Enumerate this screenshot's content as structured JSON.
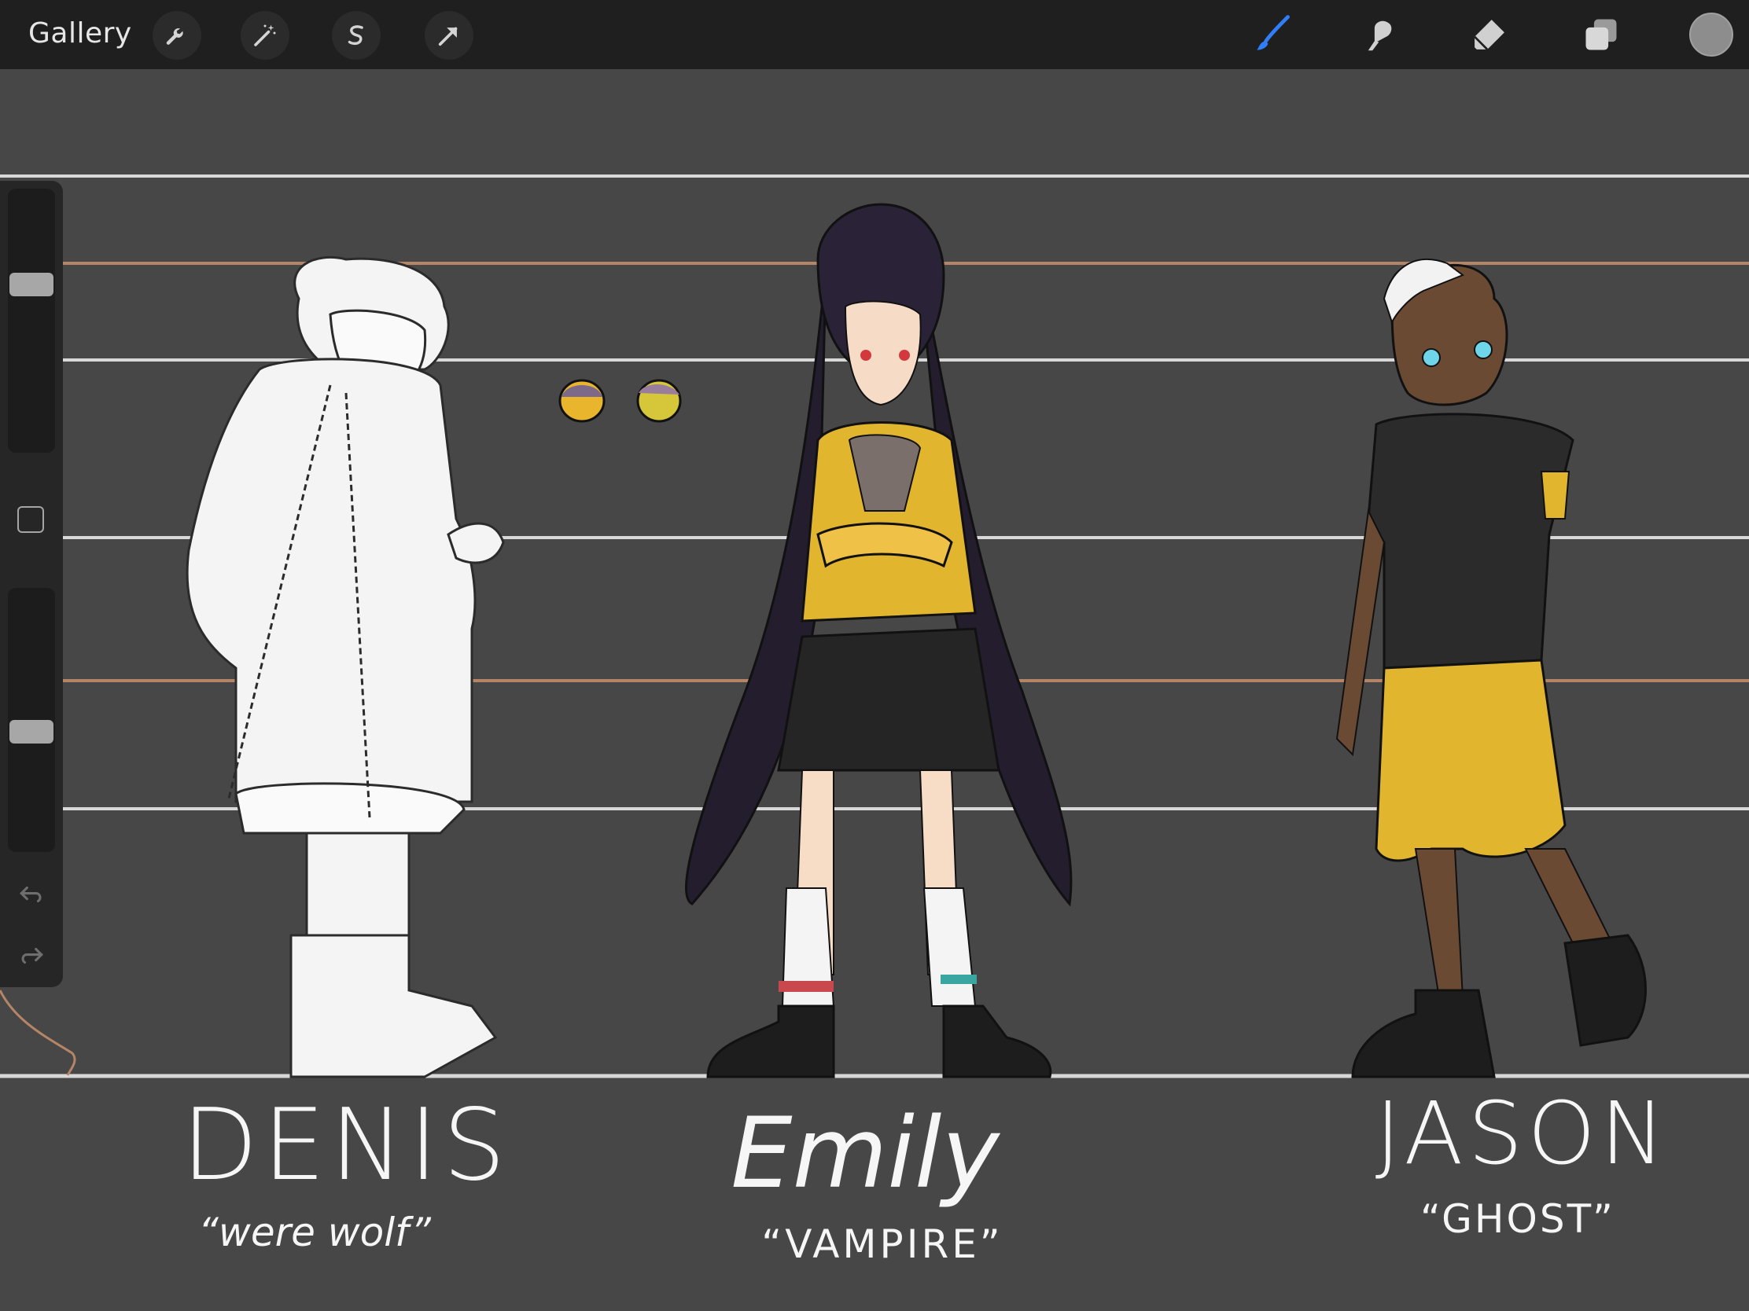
{
  "toolbar": {
    "gallery_label": "Gallery",
    "left_tools": [
      "wrench-icon",
      "magic-wand-icon",
      "selection-s-icon",
      "transform-arrow-icon"
    ],
    "right_tools": [
      "brush-icon",
      "smudge-icon",
      "eraser-icon",
      "layers-icon"
    ],
    "current_color": "#8d8d8d"
  },
  "sidebar": {
    "brush_size_level": 0.65,
    "opacity_level": 0.45,
    "buttons": [
      "modify-button",
      "undo-button",
      "redo-button"
    ]
  },
  "canvas": {
    "background": "#474747",
    "characters": [
      {
        "name": "DENIS",
        "role": "“were wolf”"
      },
      {
        "name": "Emily",
        "role": "“VAMPIRE”"
      },
      {
        "name": "JASON",
        "role": "“GHOST”"
      }
    ],
    "accent_colors": {
      "yellow": "#e2b52e",
      "skin_dark": "#6a4a33",
      "hair_dark": "#2a2236"
    }
  }
}
